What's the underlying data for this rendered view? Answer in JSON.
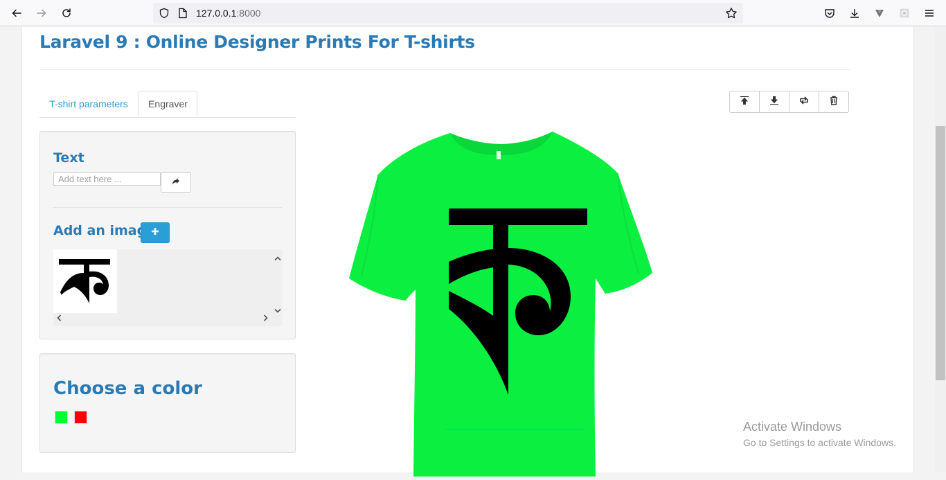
{
  "browser": {
    "url_host": "127.0.0.1",
    "url_port": ":8000",
    "icons": [
      "back-icon",
      "forward-icon",
      "reload-icon",
      "shield-icon",
      "page-icon",
      "star-icon",
      "pocket-icon",
      "download-icon",
      "extension-icon",
      "account-icon",
      "menu-icon"
    ]
  },
  "page": {
    "title": "Laravel 9 : Online Designer Prints For T-shirts"
  },
  "tabs": [
    {
      "label": "T-shirt parameters",
      "active": false
    },
    {
      "label": "Engraver",
      "active": true
    }
  ],
  "engraver": {
    "text_heading": "Text",
    "text_placeholder": "Add text here ...",
    "image_heading": "Add an image",
    "gallery_glyph": "ক"
  },
  "colors": {
    "heading": "Choose a color",
    "swatches": [
      {
        "name": "green",
        "hex": "#00ff33"
      },
      {
        "name": "red",
        "hex": "#ff0000"
      }
    ]
  },
  "design": {
    "shirt_color": "#0bef40",
    "glyph": "ক"
  },
  "toolbar_buttons": [
    "align-top-icon",
    "align-bottom-icon",
    "flip-icon",
    "trash-icon"
  ],
  "watermark": {
    "title": "Activate Windows",
    "subtitle": "Go to Settings to activate Windows."
  }
}
